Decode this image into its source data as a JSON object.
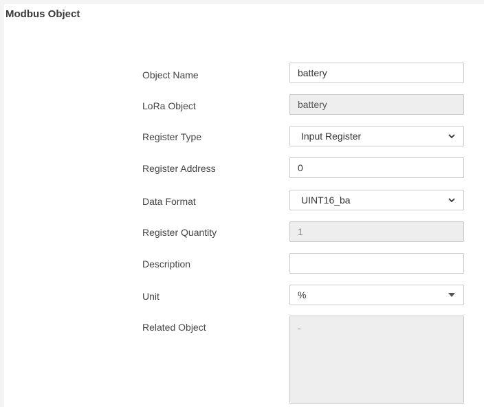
{
  "section": {
    "title": "Modbus Object"
  },
  "form": {
    "object_name": {
      "label": "Object Name",
      "value": "battery"
    },
    "lora_object": {
      "label": "LoRa Object",
      "value": "battery"
    },
    "register_type": {
      "label": "Register Type",
      "value": "Input Register"
    },
    "register_address": {
      "label": "Register Address",
      "value": "0"
    },
    "data_format": {
      "label": "Data Format",
      "value": "UINT16_ba"
    },
    "register_quantity": {
      "label": "Register Quantity",
      "value": "1"
    },
    "description": {
      "label": "Description",
      "value": ""
    },
    "unit": {
      "label": "Unit",
      "value": "%"
    },
    "related_object": {
      "label": "Related Object",
      "value": "-"
    }
  },
  "icons": {
    "register_type": "chevron-down-icon",
    "data_format": "chevron-down-icon",
    "unit": "caret-down-icon"
  }
}
